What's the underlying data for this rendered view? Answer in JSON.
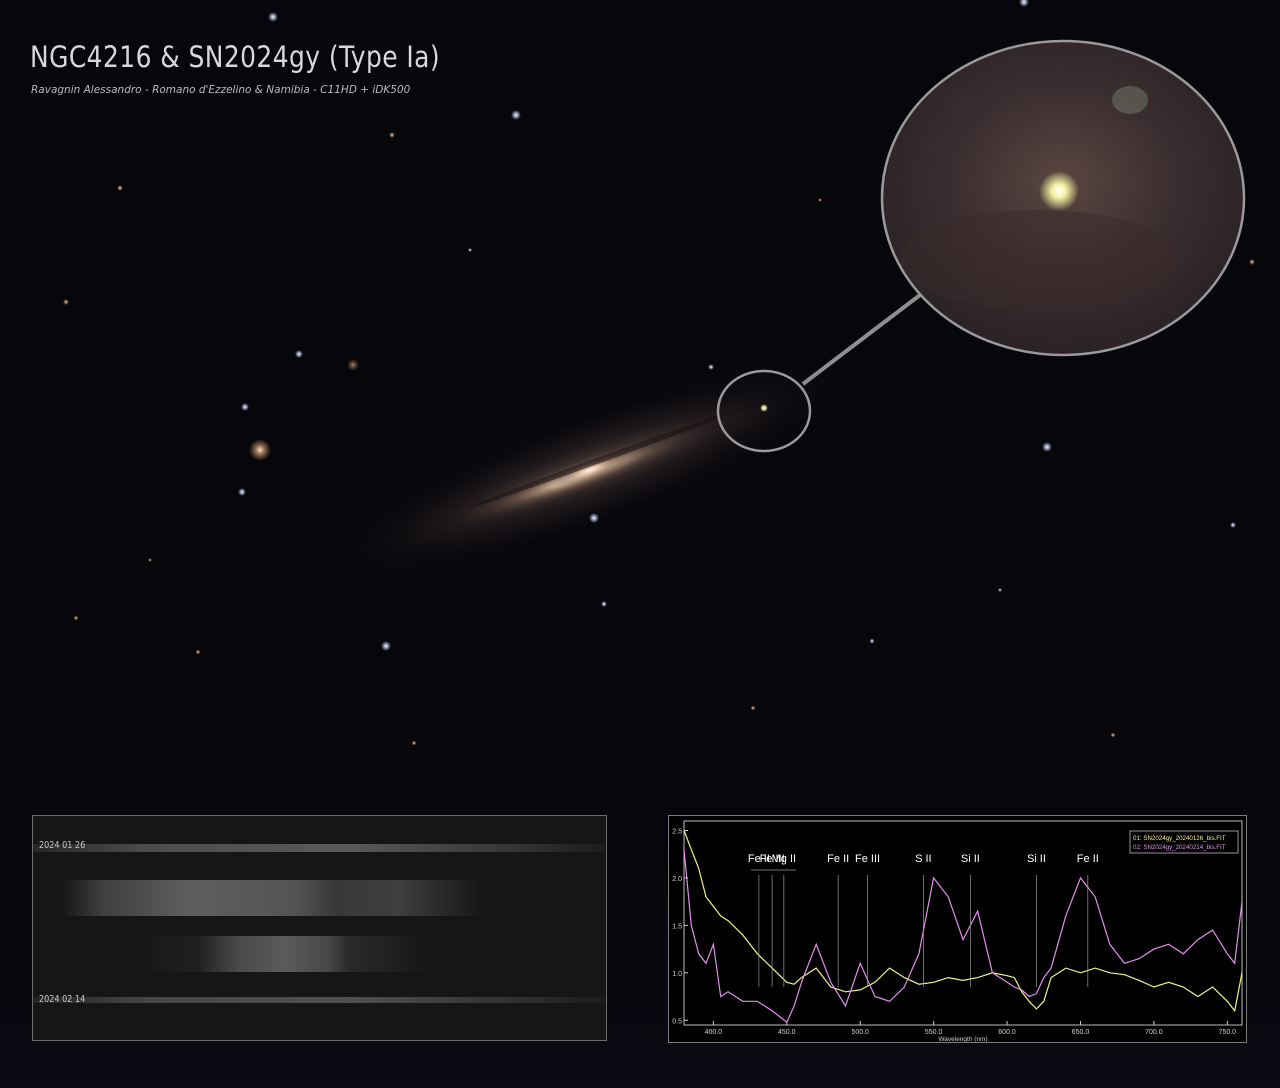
{
  "title": "NGC4216 & SN2024gy (Type Ia)",
  "credits": "Ravagnin Alessandro - Romano d'Ezzelino & Namibia - C11HD + iDK500",
  "spectra_strip": {
    "labels": [
      "2024 01 26",
      "2024 02 14"
    ]
  },
  "colors": {
    "series_1": "#f0f08a",
    "series_2": "#e090e8",
    "background": "#05050a"
  },
  "chart_data": {
    "type": "line",
    "xlabel": "Wavelength (nm)",
    "ylabel": "",
    "xlim": [
      380,
      760
    ],
    "ylim": [
      0.45,
      2.6
    ],
    "x_ticks": [
      "400.0",
      "450.0",
      "500.0",
      "550.0",
      "600.0",
      "650.0",
      "700.0",
      "750.0"
    ],
    "x_tick_values": [
      400,
      450,
      500,
      550,
      600,
      650,
      700,
      750
    ],
    "y_ticks": [
      "0.5",
      "1.0",
      "1.5",
      "2.0",
      "2.5"
    ],
    "y_tick_values": [
      0.5,
      1.0,
      1.5,
      2.0,
      2.5
    ],
    "legend": [
      "01: SN2024gy_20240126_bis.FIT",
      "02: SN2024gy_20240214_bis.FIT"
    ],
    "legend_position": "top-right",
    "line_ids": [
      {
        "label": "Fe II",
        "x": 431
      },
      {
        "label": "Fe III",
        "x": 440
      },
      {
        "label": "Mg II",
        "x": 448
      },
      {
        "label": "Fe II",
        "x": 485
      },
      {
        "label": "Fe III",
        "x": 505
      },
      {
        "label": "S II",
        "x": 543
      },
      {
        "label": "Si II",
        "x": 575
      },
      {
        "label": "Si II",
        "x": 620
      },
      {
        "label": "Fe II",
        "x": 655
      }
    ],
    "series": [
      {
        "name": "01: SN2024gy_20240126_bis.FIT",
        "x": [
          380,
          385,
          390,
          395,
          400,
          405,
          410,
          420,
          430,
          440,
          450,
          455,
          460,
          470,
          480,
          490,
          500,
          510,
          520,
          530,
          540,
          550,
          560,
          570,
          580,
          590,
          600,
          605,
          610,
          615,
          620,
          625,
          630,
          640,
          650,
          660,
          670,
          680,
          690,
          700,
          710,
          720,
          730,
          740,
          750,
          755,
          760
        ],
        "values": [
          2.5,
          2.3,
          2.1,
          1.8,
          1.7,
          1.6,
          1.55,
          1.4,
          1.2,
          1.05,
          0.9,
          0.88,
          0.95,
          1.05,
          0.85,
          0.8,
          0.82,
          0.9,
          1.05,
          0.95,
          0.88,
          0.9,
          0.95,
          0.92,
          0.95,
          1.0,
          0.97,
          0.95,
          0.8,
          0.7,
          0.62,
          0.7,
          0.95,
          1.05,
          1.0,
          1.05,
          1.0,
          0.98,
          0.92,
          0.85,
          0.9,
          0.85,
          0.75,
          0.85,
          0.7,
          0.6,
          1.0
        ]
      },
      {
        "name": "02: SN2024gy_20240214_bis.FIT",
        "x": [
          380,
          385,
          390,
          395,
          400,
          405,
          410,
          420,
          430,
          440,
          450,
          455,
          460,
          470,
          480,
          490,
          500,
          510,
          520,
          530,
          540,
          550,
          560,
          570,
          580,
          590,
          600,
          605,
          610,
          615,
          620,
          625,
          630,
          640,
          650,
          660,
          670,
          680,
          690,
          700,
          710,
          720,
          730,
          740,
          750,
          755,
          760
        ],
        "values": [
          2.3,
          1.5,
          1.2,
          1.1,
          1.3,
          0.75,
          0.8,
          0.7,
          0.7,
          0.6,
          0.48,
          0.65,
          0.9,
          1.3,
          0.9,
          0.65,
          1.1,
          0.75,
          0.7,
          0.85,
          1.2,
          2.0,
          1.8,
          1.35,
          1.65,
          1.0,
          0.9,
          0.85,
          0.82,
          0.75,
          0.78,
          0.95,
          1.05,
          1.6,
          2.0,
          1.8,
          1.3,
          1.1,
          1.15,
          1.25,
          1.3,
          1.2,
          1.35,
          1.45,
          1.2,
          1.1,
          1.75
        ]
      }
    ]
  }
}
